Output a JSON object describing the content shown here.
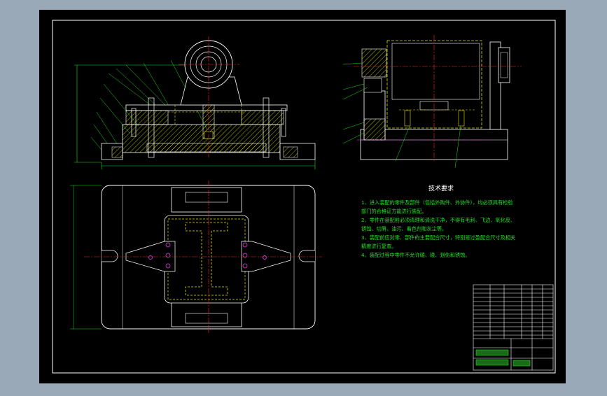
{
  "drawing": {
    "tech_title": "技术要求",
    "tech_notes": [
      "1、进入装配的零件及部件（包括外购件、外协件），均必须具有检验",
      "部门的合格证方能进行装配。",
      "2、零件在装配前必须清理和清洗干净，不得有毛刺、飞边、氧化皮、",
      "锈蚀、切屑、油污、着色剂和灰尘等。",
      "3、装配前应对零、部件的主要配合尺寸，特别是过盈配合尺寸及相关",
      "精度进行复查。",
      "4、装配过程中零件不允许磕、碰、划伤和锈蚀。"
    ]
  },
  "colors": {
    "sheet": "#000000",
    "outer_bg": "#9aa9b8",
    "line": "#ffffff",
    "hidden": "#e8e000",
    "center": "#ff2020",
    "dim": "#20e020",
    "hatch": "#e0e000",
    "bolt": "#ff40ff"
  }
}
